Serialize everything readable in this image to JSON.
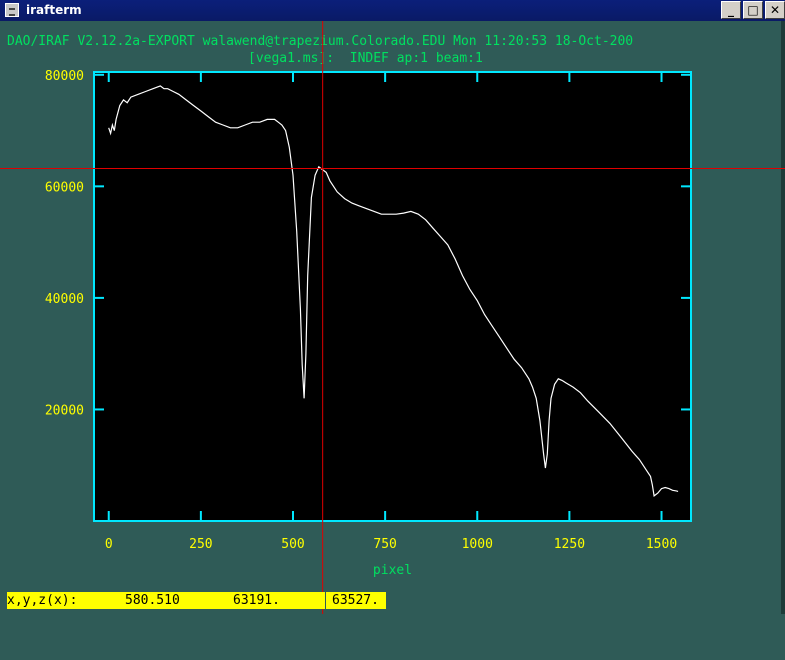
{
  "window": {
    "title": "irafterm",
    "buttons": {
      "minimize": "_",
      "maximize": "□",
      "close": "✕"
    }
  },
  "header": {
    "line1": "DAO/IRAF V2.12.2a-EXPORT walawend@trapezium.Colorado.EDU Mon 11:20:53 18-Oct-200",
    "line2": "[vega1.ms]:  INDEF ap:1 beam:1"
  },
  "status": {
    "label": "x,y,z(x):",
    "x": "580.510",
    "y": "63191.",
    "z": "63527."
  },
  "cursor": {
    "x": 580.51,
    "y": 63191
  },
  "colors": {
    "axes": "#00e8ff",
    "ticklabels": "#ffff00",
    "text": "#00e060",
    "trace": "#ffffff",
    "cursor": "#e00000",
    "status_bg": "#ffff00"
  },
  "chart_data": {
    "type": "line",
    "xlabel": "pixel",
    "ylabel": "",
    "title": "",
    "xlim": [
      -40,
      1580
    ],
    "ylim": [
      0,
      80500
    ],
    "xticks": [
      0,
      250,
      500,
      750,
      1000,
      1250,
      1500
    ],
    "xtick_labels": [
      "0",
      "250",
      "500",
      "750",
      "1000",
      "1250",
      "1500"
    ],
    "yticks": [
      20000,
      40000,
      60000,
      80000
    ],
    "ytick_labels": [
      "20000",
      "40000",
      "60000",
      "80000"
    ],
    "series": [
      {
        "x": [
          0,
          5,
          10,
          15,
          20,
          30,
          40,
          50,
          60,
          80,
          100,
          120,
          140,
          150,
          160,
          175,
          190,
          210,
          230,
          250,
          270,
          290,
          310,
          330,
          350,
          370,
          390,
          410,
          430,
          450,
          460,
          470,
          480,
          490,
          500,
          510,
          520,
          525,
          530,
          535,
          540,
          550,
          560,
          570,
          580,
          590,
          600,
          610,
          620,
          640,
          660,
          680,
          700,
          720,
          740,
          760,
          780,
          800,
          820,
          840,
          860,
          880,
          900,
          920,
          940,
          960,
          980,
          1000,
          1020,
          1040,
          1060,
          1080,
          1100,
          1120,
          1140,
          1150,
          1160,
          1170,
          1180,
          1185,
          1190,
          1195,
          1200,
          1210,
          1220,
          1230,
          1240,
          1260,
          1280,
          1300,
          1330,
          1360,
          1390,
          1420,
          1440,
          1460,
          1470,
          1475,
          1480,
          1490,
          1500,
          1510,
          1520,
          1530,
          1540,
          1545
        ],
        "y": [
          70500,
          69500,
          71000,
          70000,
          72000,
          74500,
          75500,
          75000,
          76000,
          76500,
          77000,
          77500,
          78000,
          77500,
          77500,
          77000,
          76500,
          75500,
          74500,
          73500,
          72500,
          71500,
          71000,
          70500,
          70500,
          71000,
          71500,
          71500,
          72000,
          72000,
          71500,
          71000,
          70000,
          67000,
          62000,
          52000,
          38000,
          28000,
          22000,
          30000,
          44000,
          58000,
          62000,
          63500,
          63000,
          62500,
          61000,
          60000,
          59000,
          57800,
          57000,
          56500,
          56000,
          55500,
          55000,
          55000,
          55000,
          55200,
          55500,
          55000,
          54000,
          52500,
          51000,
          49500,
          47000,
          44000,
          41500,
          39500,
          37000,
          35000,
          33000,
          31000,
          29000,
          27500,
          25500,
          24000,
          22000,
          18000,
          12000,
          9500,
          12000,
          18000,
          22000,
          24500,
          25500,
          25200,
          24800,
          24000,
          23000,
          21500,
          19500,
          17500,
          15000,
          12500,
          11000,
          9000,
          8000,
          6500,
          4500,
          5000,
          5800,
          6000,
          5800,
          5500,
          5400,
          5300
        ]
      }
    ]
  }
}
